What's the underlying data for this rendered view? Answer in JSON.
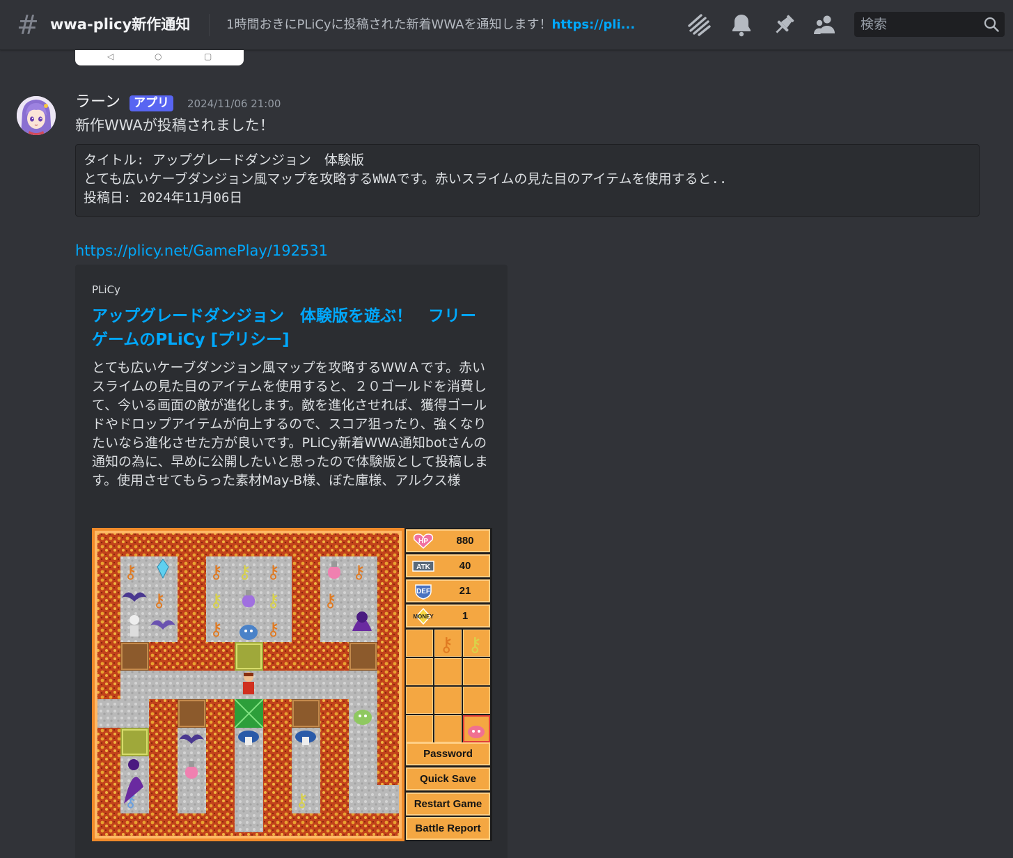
{
  "header": {
    "channel_name": "wwa-plicy新作通知",
    "topic_text": "1時間おきにPLiCyに投稿された新着WWAを通知します！",
    "topic_link": "https://pli...",
    "search_placeholder": "検索",
    "icons": [
      "hash-icon",
      "threads-icon",
      "bell-icon",
      "pin-icon",
      "members-icon",
      "search-icon"
    ]
  },
  "message": {
    "author": "ラーン",
    "badge": "アプリ",
    "timestamp": "2024/11/06 21:00",
    "text": "新作WWAが投稿されました！",
    "code_lines": [
      "タイトル: アップグレードダンジョン　体験版",
      "とても広いケーブダンジョン風マップを攻略するWWAです。赤いスライムの見た目のアイテムを使用すると..",
      "投稿日: 2024年11月06日"
    ],
    "url": "https://plicy.net/GamePlay/192531"
  },
  "embed": {
    "site": "PLiCy",
    "title": "アップグレードダンジョン　体験版を遊ぶ！　フリーゲームのPLiCy [プリシー]",
    "description": "とても広いケーブダンジョン風マップを攻略するWWＡです。赤いスライムの見た目のアイテムを使用すると、２０ゴールドを消費して、今いる画面の敵が進化します。敵を進化させれば、獲得ゴールドやドロップアイテムが向上するので、スコア狙ったり、強くなりたいなら進化させた方が良いです。PLiCy新着WWA通知botさんの通知の為に、早めに公開したいと思ったので体験版として投稿します。使用させてもらった素材May-B様、ぼた庫様、アルクス様"
  },
  "game": {
    "stats": [
      {
        "label": "HP",
        "value": "880"
      },
      {
        "label": "ATK",
        "value": "40"
      },
      {
        "label": "DEF",
        "value": "21"
      },
      {
        "label": "MONEY",
        "value": "1"
      }
    ],
    "buttons": [
      "Password",
      "Quick Save",
      "Restart Game",
      "Battle Report"
    ],
    "colors": {
      "lava": "#c0401a",
      "floor": "#b8b8b8",
      "panel": "#f4a742",
      "frame": "#f08a2a"
    }
  }
}
